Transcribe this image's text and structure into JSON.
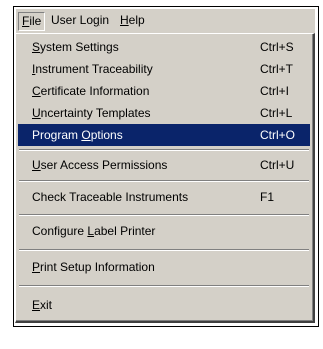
{
  "menubar": {
    "items": [
      {
        "prefix": "",
        "mnemonic": "F",
        "suffix": "ile"
      },
      {
        "prefix": "User Lo",
        "mnemonic": "g",
        "suffix": "in"
      },
      {
        "prefix": "",
        "mnemonic": "H",
        "suffix": "elp"
      }
    ]
  },
  "file_menu": {
    "items": [
      {
        "prefix": "",
        "mnemonic": "S",
        "suffix": "ystem Settings",
        "shortcut": "Ctrl+S"
      },
      {
        "prefix": "",
        "mnemonic": "I",
        "suffix": "nstrument Traceability",
        "shortcut": "Ctrl+T"
      },
      {
        "prefix": "",
        "mnemonic": "C",
        "suffix": "ertificate Information",
        "shortcut": "Ctrl+I"
      },
      {
        "prefix": "",
        "mnemonic": "U",
        "suffix": "ncertainty Templates",
        "shortcut": "Ctrl+L"
      },
      {
        "prefix": "Program ",
        "mnemonic": "O",
        "suffix": "ptions",
        "shortcut": "Ctrl+O"
      },
      {
        "prefix": "",
        "mnemonic": "U",
        "suffix": "ser Access Permissions",
        "shortcut": "Ctrl+U"
      },
      {
        "prefix": "Check Traceable Instruments",
        "mnemonic": "",
        "suffix": "",
        "shortcut": "F1"
      },
      {
        "prefix": "Configure ",
        "mnemonic": "L",
        "suffix": "abel Printer",
        "shortcut": ""
      },
      {
        "prefix": "",
        "mnemonic": "P",
        "suffix": "rint Setup Information",
        "shortcut": ""
      },
      {
        "prefix": "",
        "mnemonic": "E",
        "suffix": "xit",
        "shortcut": ""
      }
    ],
    "selected_index": 4
  },
  "colors": {
    "menu_face": "#d4d0c8",
    "highlight": "#0a246a",
    "highlight_text": "#ffffff"
  }
}
